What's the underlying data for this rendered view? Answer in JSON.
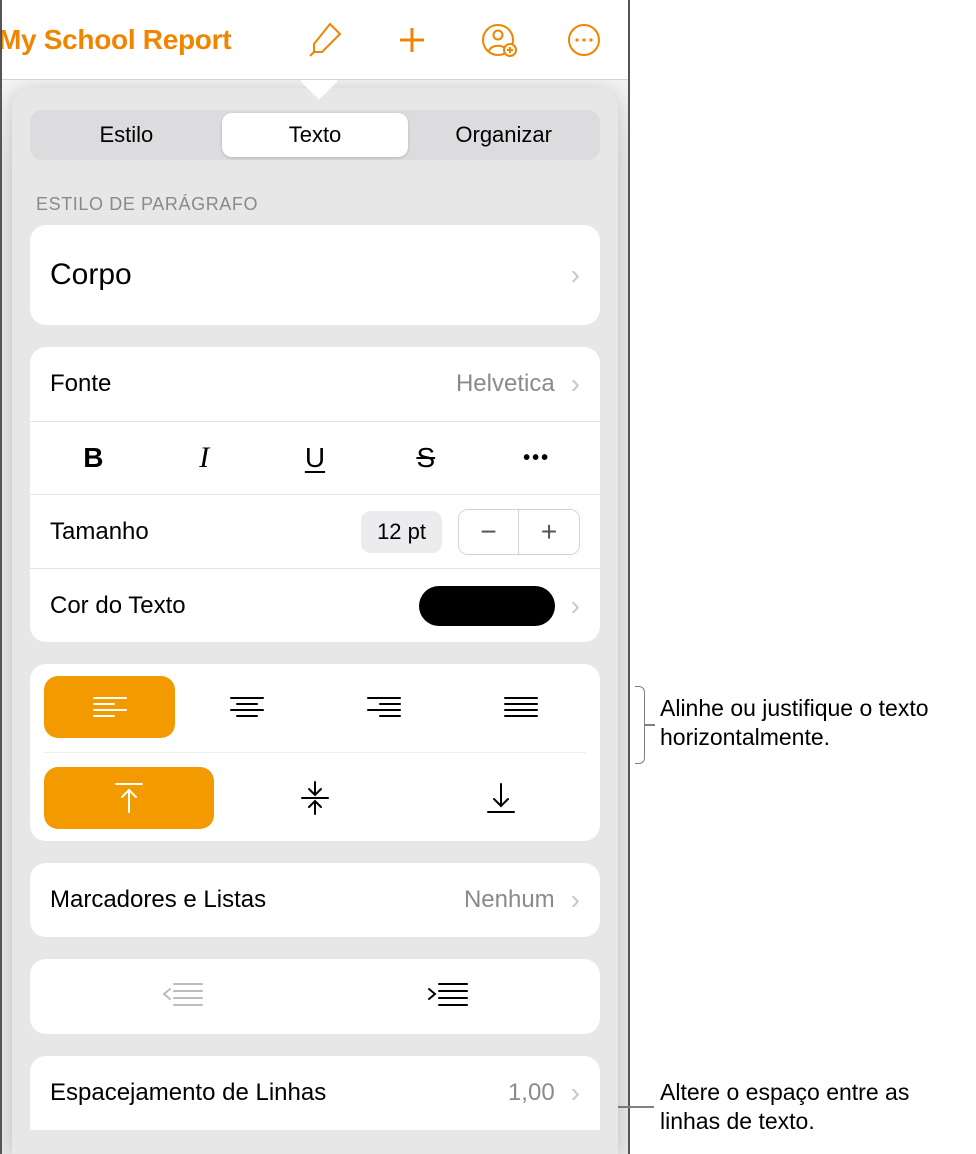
{
  "header": {
    "title": "My School Report"
  },
  "tabs": {
    "style": "Estilo",
    "text": "Texto",
    "arrange": "Organizar"
  },
  "paragraph": {
    "section_label": "ESTILO DE PARÁGRAFO",
    "value": "Corpo"
  },
  "font": {
    "label": "Fonte",
    "value": "Helvetica",
    "bold": "B",
    "italic": "I",
    "underline": "U",
    "strike": "S",
    "more": "•••",
    "size_label": "Tamanho",
    "size_value": "12 pt",
    "minus": "−",
    "plus": "+",
    "color_label": "Cor do Texto"
  },
  "bullets": {
    "label": "Marcadores e Listas",
    "value": "Nenhum"
  },
  "lineSpacing": {
    "label": "Espacejamento de Linhas",
    "value": "1,00"
  },
  "annotations": {
    "align": "Alinhe ou justifique o texto horizontalmente.",
    "spacing": "Altere o espaço entre as linhas de texto."
  }
}
